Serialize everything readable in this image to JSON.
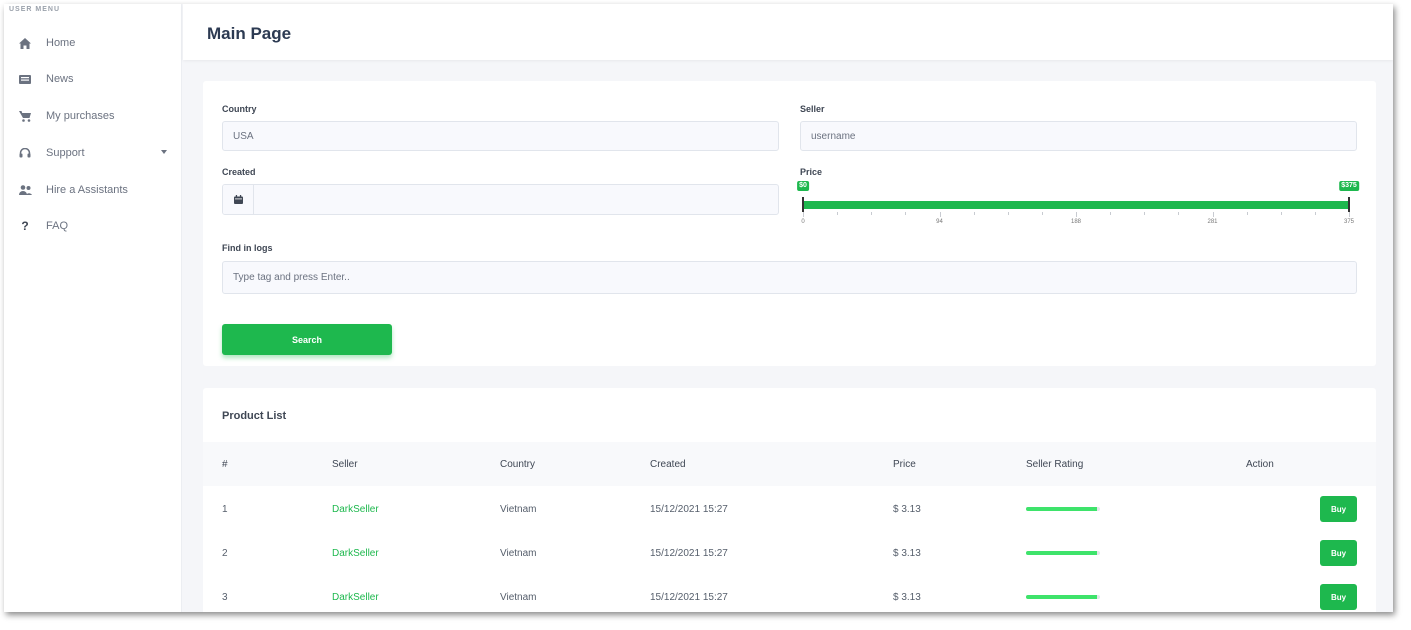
{
  "sidebar": {
    "heading": "USER MENU",
    "items": [
      {
        "label": "Home",
        "icon": "home-icon"
      },
      {
        "label": "News",
        "icon": "news-icon"
      },
      {
        "label": "My purchases",
        "icon": "cart-icon"
      },
      {
        "label": "Support",
        "icon": "headset-icon"
      },
      {
        "label": "Hire a Assistants",
        "icon": "users-icon"
      },
      {
        "label": "FAQ",
        "icon": "question-icon"
      }
    ]
  },
  "header": {
    "title": "Main Page"
  },
  "filters": {
    "country": {
      "label": "Country",
      "value": "USA"
    },
    "seller": {
      "label": "Seller",
      "placeholder": "username"
    },
    "created": {
      "label": "Created",
      "value": ""
    },
    "price": {
      "label": "Price",
      "min": 0,
      "max": 375,
      "from": 0,
      "to": 375,
      "from_label": "$0",
      "to_label": "$375",
      "ticks": [
        "0",
        "94",
        "188",
        "281",
        "375"
      ]
    },
    "logs": {
      "label": "Find in logs",
      "placeholder": "Type tag and press Enter.."
    },
    "search_label": "Search"
  },
  "product_list": {
    "title": "Product List",
    "columns": [
      "#",
      "Seller",
      "Country",
      "Created",
      "Price",
      "Seller Rating",
      "Action"
    ],
    "rows": [
      {
        "index": "1",
        "seller": "DarkSeller",
        "country": "Vietnam",
        "created": "15/12/2021 15:27",
        "price": "$ 3.13",
        "rating": 0.96,
        "action": "Buy"
      },
      {
        "index": "2",
        "seller": "DarkSeller",
        "country": "Vietnam",
        "created": "15/12/2021 15:27",
        "price": "$ 3.13",
        "rating": 0.96,
        "action": "Buy"
      },
      {
        "index": "3",
        "seller": "DarkSeller",
        "country": "Vietnam",
        "created": "15/12/2021 15:27",
        "price": "$ 3.13",
        "rating": 0.96,
        "action": "Buy"
      }
    ]
  },
  "colors": {
    "accent": "#1eb84e",
    "rating": "#3ee36b",
    "title": "#2c3a52"
  }
}
